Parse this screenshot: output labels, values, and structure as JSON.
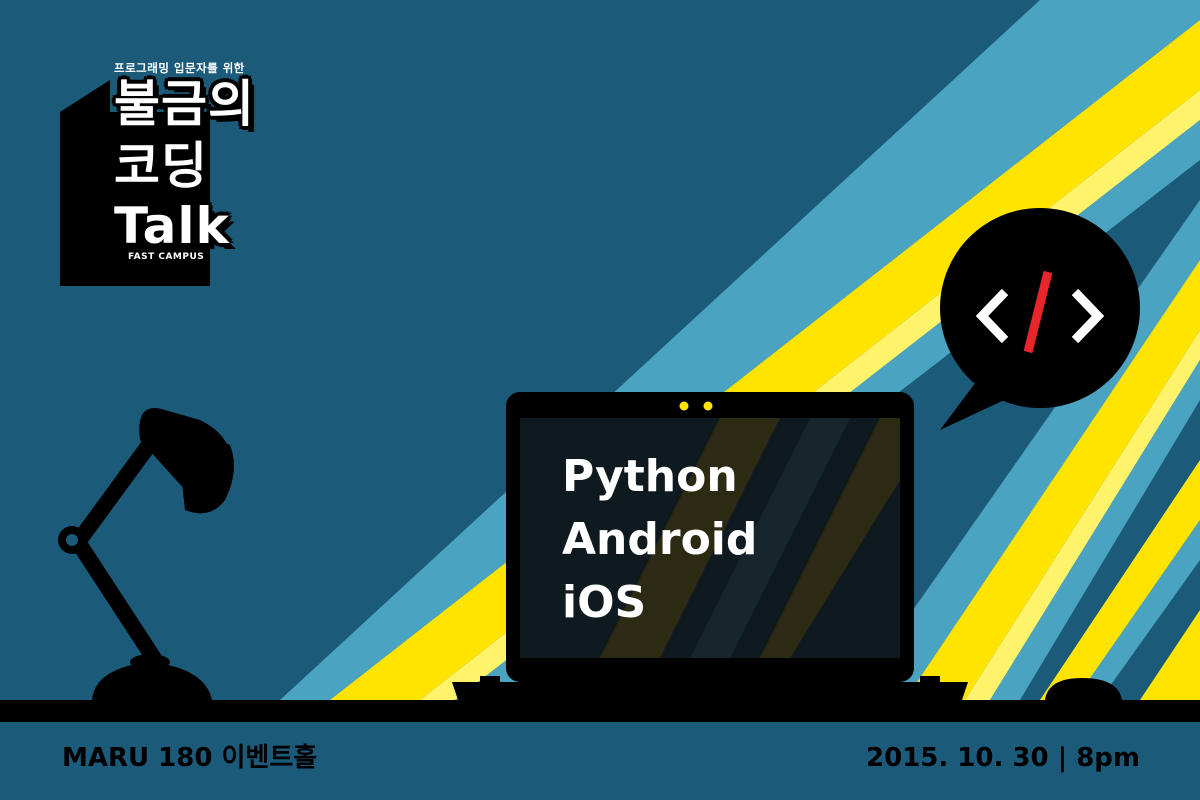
{
  "logo": {
    "subtitle": "프로그래밍 입문자를 위한",
    "line1": "불금의",
    "line2": "코딩",
    "line3": "Talk",
    "brand": "FAST CAMPUS"
  },
  "screen": {
    "topics": [
      "Python",
      "Android",
      "iOS"
    ]
  },
  "speech_bubble": {
    "icon": "code-brackets-icon"
  },
  "footer": {
    "venue": "MARU 180 이벤트홀",
    "date": "2015. 10. 30 | 8pm"
  },
  "colors": {
    "background": "#1b5a78",
    "beam_yellow": "#ffe400",
    "beam_light_yellow": "#fff36b",
    "beam_blue": "#4aa3c0",
    "silhouette": "#000000",
    "code_slash": "#e8252a"
  }
}
